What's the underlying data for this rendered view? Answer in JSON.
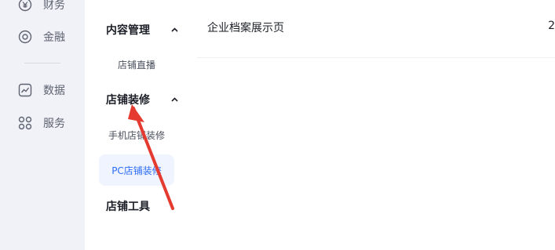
{
  "left_rail": {
    "items": [
      {
        "label": "财务",
        "icon": "yuan-circle-icon"
      },
      {
        "label": "金融",
        "icon": "target-circle-icon"
      },
      {
        "label": "数据",
        "icon": "chart-line-icon"
      },
      {
        "label": "服务",
        "icon": "grid-circles-icon"
      }
    ]
  },
  "sub_nav": {
    "group1": {
      "label": "内容管理",
      "icon": "chevron-up-icon"
    },
    "group1_items": [
      "店铺直播"
    ],
    "group2": {
      "label": "店铺装修",
      "icon": "chevron-up-icon"
    },
    "group2_items": [
      "手机店铺装修",
      "PC店铺装修"
    ],
    "group3": {
      "label": "店铺工具"
    }
  },
  "main": {
    "row_title": "企业档案展示页",
    "row_count": "2"
  },
  "colors": {
    "accent": "#2c6cf6",
    "annotation_arrow": "#e53a2f",
    "rail_bg": "#f1f2f7",
    "active_bg": "#f0f4ff"
  }
}
